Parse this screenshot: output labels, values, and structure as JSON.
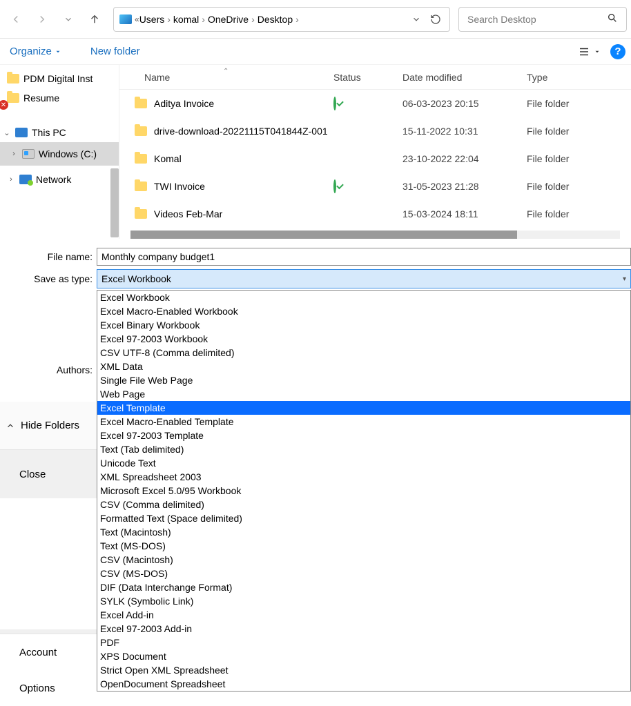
{
  "nav": {
    "breadcrumb": [
      "Users",
      "komal",
      "OneDrive",
      "Desktop"
    ],
    "search_placeholder": "Search Desktop"
  },
  "toolbar": {
    "organize": "Organize",
    "new_folder": "New folder"
  },
  "tree": {
    "items": [
      {
        "label": "PDM Digital Inst"
      },
      {
        "label": "Resume"
      }
    ],
    "this_pc": "This PC",
    "windows_c": "Windows (C:)",
    "network": "Network"
  },
  "columns": {
    "name": "Name",
    "status": "Status",
    "date": "Date modified",
    "type": "Type"
  },
  "files": [
    {
      "name": "Aditya Invoice",
      "status": "ok",
      "date": "06-03-2023 20:15",
      "type": "File folder"
    },
    {
      "name": "drive-download-20221115T041844Z-001",
      "status": "err",
      "date": "15-11-2022 10:31",
      "type": "File folder"
    },
    {
      "name": "Komal",
      "status": "err",
      "date": "23-10-2022 22:04",
      "type": "File folder"
    },
    {
      "name": "TWI Invoice",
      "status": "ok",
      "date": "31-05-2023 21:28",
      "type": "File folder"
    },
    {
      "name": "Videos Feb-Mar",
      "status": "err",
      "date": "15-03-2024 18:11",
      "type": "File folder"
    }
  ],
  "form": {
    "file_name_label": "File name:",
    "file_name_value": "Monthly company budget1",
    "save_as_type_label": "Save as type:",
    "save_as_type_value": "Excel Workbook",
    "authors_label": "Authors:"
  },
  "type_options": [
    "Excel Workbook",
    "Excel Macro-Enabled Workbook",
    "Excel Binary Workbook",
    "Excel 97-2003 Workbook",
    "CSV UTF-8 (Comma delimited)",
    "XML Data",
    "Single File Web Page",
    "Web Page",
    "Excel Template",
    "Excel Macro-Enabled Template",
    "Excel 97-2003 Template",
    "Text (Tab delimited)",
    "Unicode Text",
    "XML Spreadsheet 2003",
    "Microsoft Excel 5.0/95 Workbook",
    "CSV (Comma delimited)",
    "Formatted Text (Space delimited)",
    "Text (Macintosh)",
    "Text (MS-DOS)",
    "CSV (Macintosh)",
    "CSV (MS-DOS)",
    "DIF (Data Interchange Format)",
    "SYLK (Symbolic Link)",
    "Excel Add-in",
    "Excel 97-2003 Add-in",
    "PDF",
    "XPS Document",
    "Strict Open XML Spreadsheet",
    "OpenDocument Spreadsheet"
  ],
  "highlighted_option": "Excel Template",
  "bottom": {
    "hide_folders": "Hide Folders",
    "close": "Close",
    "account": "Account",
    "options": "Options"
  }
}
